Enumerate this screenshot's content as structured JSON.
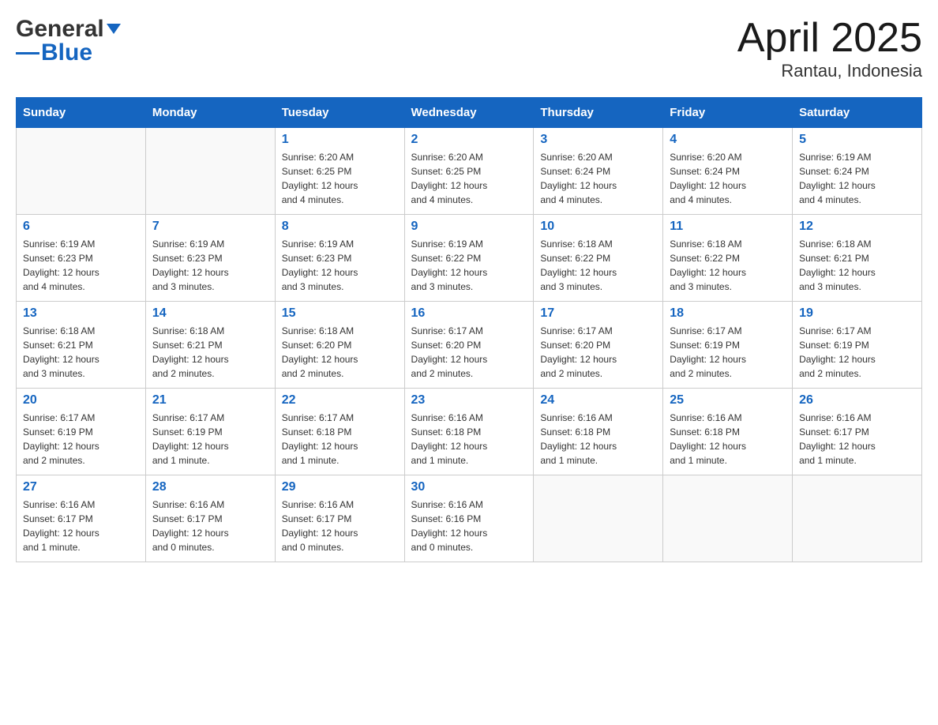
{
  "header": {
    "logo": {
      "part1": "General",
      "part2": "Blue"
    },
    "title": "April 2025",
    "location": "Rantau, Indonesia"
  },
  "weekdays": [
    "Sunday",
    "Monday",
    "Tuesday",
    "Wednesday",
    "Thursday",
    "Friday",
    "Saturday"
  ],
  "weeks": [
    [
      {
        "day": "",
        "info": ""
      },
      {
        "day": "",
        "info": ""
      },
      {
        "day": "1",
        "info": "Sunrise: 6:20 AM\nSunset: 6:25 PM\nDaylight: 12 hours\nand 4 minutes."
      },
      {
        "day": "2",
        "info": "Sunrise: 6:20 AM\nSunset: 6:25 PM\nDaylight: 12 hours\nand 4 minutes."
      },
      {
        "day": "3",
        "info": "Sunrise: 6:20 AM\nSunset: 6:24 PM\nDaylight: 12 hours\nand 4 minutes."
      },
      {
        "day": "4",
        "info": "Sunrise: 6:20 AM\nSunset: 6:24 PM\nDaylight: 12 hours\nand 4 minutes."
      },
      {
        "day": "5",
        "info": "Sunrise: 6:19 AM\nSunset: 6:24 PM\nDaylight: 12 hours\nand 4 minutes."
      }
    ],
    [
      {
        "day": "6",
        "info": "Sunrise: 6:19 AM\nSunset: 6:23 PM\nDaylight: 12 hours\nand 4 minutes."
      },
      {
        "day": "7",
        "info": "Sunrise: 6:19 AM\nSunset: 6:23 PM\nDaylight: 12 hours\nand 3 minutes."
      },
      {
        "day": "8",
        "info": "Sunrise: 6:19 AM\nSunset: 6:23 PM\nDaylight: 12 hours\nand 3 minutes."
      },
      {
        "day": "9",
        "info": "Sunrise: 6:19 AM\nSunset: 6:22 PM\nDaylight: 12 hours\nand 3 minutes."
      },
      {
        "day": "10",
        "info": "Sunrise: 6:18 AM\nSunset: 6:22 PM\nDaylight: 12 hours\nand 3 minutes."
      },
      {
        "day": "11",
        "info": "Sunrise: 6:18 AM\nSunset: 6:22 PM\nDaylight: 12 hours\nand 3 minutes."
      },
      {
        "day": "12",
        "info": "Sunrise: 6:18 AM\nSunset: 6:21 PM\nDaylight: 12 hours\nand 3 minutes."
      }
    ],
    [
      {
        "day": "13",
        "info": "Sunrise: 6:18 AM\nSunset: 6:21 PM\nDaylight: 12 hours\nand 3 minutes."
      },
      {
        "day": "14",
        "info": "Sunrise: 6:18 AM\nSunset: 6:21 PM\nDaylight: 12 hours\nand 2 minutes."
      },
      {
        "day": "15",
        "info": "Sunrise: 6:18 AM\nSunset: 6:20 PM\nDaylight: 12 hours\nand 2 minutes."
      },
      {
        "day": "16",
        "info": "Sunrise: 6:17 AM\nSunset: 6:20 PM\nDaylight: 12 hours\nand 2 minutes."
      },
      {
        "day": "17",
        "info": "Sunrise: 6:17 AM\nSunset: 6:20 PM\nDaylight: 12 hours\nand 2 minutes."
      },
      {
        "day": "18",
        "info": "Sunrise: 6:17 AM\nSunset: 6:19 PM\nDaylight: 12 hours\nand 2 minutes."
      },
      {
        "day": "19",
        "info": "Sunrise: 6:17 AM\nSunset: 6:19 PM\nDaylight: 12 hours\nand 2 minutes."
      }
    ],
    [
      {
        "day": "20",
        "info": "Sunrise: 6:17 AM\nSunset: 6:19 PM\nDaylight: 12 hours\nand 2 minutes."
      },
      {
        "day": "21",
        "info": "Sunrise: 6:17 AM\nSunset: 6:19 PM\nDaylight: 12 hours\nand 1 minute."
      },
      {
        "day": "22",
        "info": "Sunrise: 6:17 AM\nSunset: 6:18 PM\nDaylight: 12 hours\nand 1 minute."
      },
      {
        "day": "23",
        "info": "Sunrise: 6:16 AM\nSunset: 6:18 PM\nDaylight: 12 hours\nand 1 minute."
      },
      {
        "day": "24",
        "info": "Sunrise: 6:16 AM\nSunset: 6:18 PM\nDaylight: 12 hours\nand 1 minute."
      },
      {
        "day": "25",
        "info": "Sunrise: 6:16 AM\nSunset: 6:18 PM\nDaylight: 12 hours\nand 1 minute."
      },
      {
        "day": "26",
        "info": "Sunrise: 6:16 AM\nSunset: 6:17 PM\nDaylight: 12 hours\nand 1 minute."
      }
    ],
    [
      {
        "day": "27",
        "info": "Sunrise: 6:16 AM\nSunset: 6:17 PM\nDaylight: 12 hours\nand 1 minute."
      },
      {
        "day": "28",
        "info": "Sunrise: 6:16 AM\nSunset: 6:17 PM\nDaylight: 12 hours\nand 0 minutes."
      },
      {
        "day": "29",
        "info": "Sunrise: 6:16 AM\nSunset: 6:17 PM\nDaylight: 12 hours\nand 0 minutes."
      },
      {
        "day": "30",
        "info": "Sunrise: 6:16 AM\nSunset: 6:16 PM\nDaylight: 12 hours\nand 0 minutes."
      },
      {
        "day": "",
        "info": ""
      },
      {
        "day": "",
        "info": ""
      },
      {
        "day": "",
        "info": ""
      }
    ]
  ]
}
